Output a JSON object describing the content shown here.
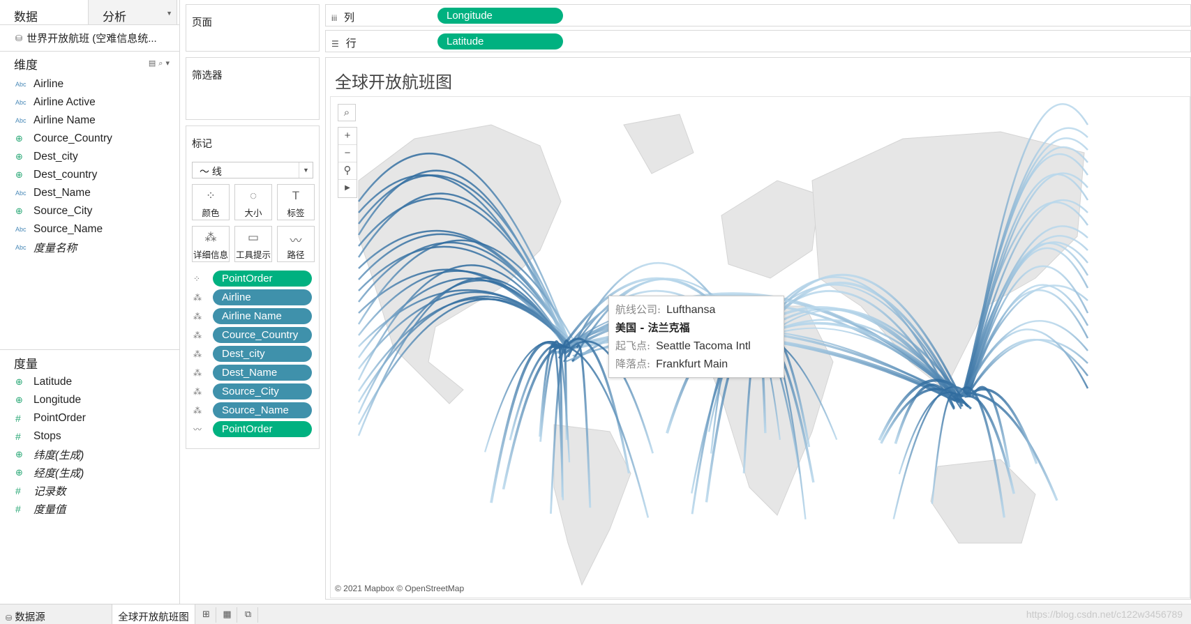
{
  "left_pane": {
    "tabs": [
      "数据",
      "分析"
    ],
    "datasource": "世界开放航班 (空难信息统...",
    "dimensions_title": "维度",
    "dimensions": [
      {
        "name": "Airline",
        "type": "Abc",
        "italic": false
      },
      {
        "name": "Airline Active",
        "type": "Abc",
        "italic": false
      },
      {
        "name": "Airline Name",
        "type": "Abc",
        "italic": false
      },
      {
        "name": "Cource_Country",
        "type": "geo",
        "italic": false
      },
      {
        "name": "Dest_city",
        "type": "geo",
        "italic": false
      },
      {
        "name": "Dest_country",
        "type": "geo",
        "italic": false
      },
      {
        "name": "Dest_Name",
        "type": "Abc",
        "italic": false
      },
      {
        "name": "Source_City",
        "type": "geo",
        "italic": false
      },
      {
        "name": "Source_Name",
        "type": "Abc",
        "italic": false
      },
      {
        "name": "度量名称",
        "type": "Abc",
        "italic": true
      }
    ],
    "measures_title": "度量",
    "measures": [
      {
        "name": "Latitude",
        "type": "geo",
        "italic": false
      },
      {
        "name": "Longitude",
        "type": "geo",
        "italic": false
      },
      {
        "name": "PointOrder",
        "type": "num",
        "italic": false
      },
      {
        "name": "Stops",
        "type": "num",
        "italic": false
      },
      {
        "name": "纬度(生成)",
        "type": "geo",
        "italic": true
      },
      {
        "name": "经度(生成)",
        "type": "geo",
        "italic": true
      },
      {
        "name": "记录数",
        "type": "num",
        "italic": true
      },
      {
        "name": "度量值",
        "type": "num",
        "italic": true
      }
    ]
  },
  "cards": {
    "pages": "页面",
    "filters": "筛选器",
    "marks": "标记",
    "mark_type": "线",
    "mark_buttons": [
      {
        "label": "颜色",
        "icon": "color-icon"
      },
      {
        "label": "大小",
        "icon": "size-icon"
      },
      {
        "label": "标签",
        "icon": "label-icon"
      },
      {
        "label": "详细信息",
        "icon": "detail-icon"
      },
      {
        "label": "工具提示",
        "icon": "tooltip-icon"
      },
      {
        "label": "路径",
        "icon": "path-icon"
      }
    ],
    "mark_pills": [
      {
        "label": "PointOrder",
        "color": "green",
        "icon": "color-icon"
      },
      {
        "label": "Airline",
        "color": "teal",
        "icon": "detail-icon"
      },
      {
        "label": "Airline Name",
        "color": "teal",
        "icon": "detail-icon"
      },
      {
        "label": "Cource_Country",
        "color": "teal",
        "icon": "detail-icon"
      },
      {
        "label": "Dest_city",
        "color": "teal",
        "icon": "detail-icon"
      },
      {
        "label": "Dest_Name",
        "color": "teal",
        "icon": "detail-icon"
      },
      {
        "label": "Source_City",
        "color": "teal",
        "icon": "detail-icon"
      },
      {
        "label": "Source_Name",
        "color": "teal",
        "icon": "detail-icon"
      },
      {
        "label": "PointOrder",
        "color": "green",
        "icon": "path-icon"
      }
    ]
  },
  "shelves": {
    "columns_label": "列",
    "columns_pill": "Longitude",
    "rows_label": "行",
    "rows_pill": "Latitude"
  },
  "viz": {
    "title": "全球开放航班图",
    "attribution": "© 2021 Mapbox © OpenStreetMap",
    "tooltip": {
      "airline_label": "航线公司:",
      "airline_value": "Lufthansa",
      "route": "美国 - 法兰克福",
      "source_label": "起飞点:",
      "source_value": "Seattle Tacoma Intl",
      "dest_label": "降落点:",
      "dest_value": "Frankfurt Main"
    }
  },
  "bottom_bar": {
    "datasource_tab": "数据源",
    "sheet_tab": "全球开放航班图",
    "watermark": "https://blog.csdn.net/c122w3456789"
  },
  "colors": {
    "green_pill": "#00b180",
    "teal_pill": "#3f91ab",
    "route_dark": "#2f6b9e",
    "route_light": "#b9d8ec",
    "land": "#e6e6e6"
  }
}
